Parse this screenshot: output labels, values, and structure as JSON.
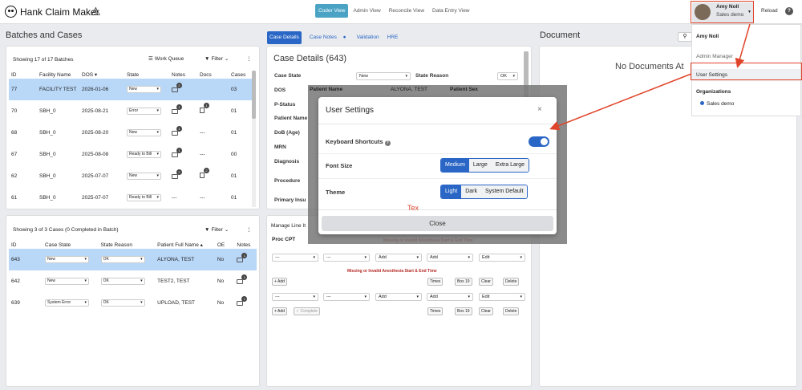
{
  "app": {
    "title": "Hank Claim Maker",
    "nav": [
      "Coder View",
      "Admin View",
      "Reconcile View",
      "Data Entry View"
    ],
    "active_nav": "Coder View"
  },
  "user": {
    "name": "Amy Noll",
    "org": "Sales demo",
    "reload": "Reload",
    "help": "?"
  },
  "dropdown": {
    "name": "Amy Noll",
    "role": "Admin Manager",
    "settings": "User Settings",
    "orgs_heading": "Organizations",
    "org": "Sales demo"
  },
  "batches": {
    "title": "Batches and Cases",
    "showing": "Showing 17 of 17 Batches",
    "work_queue": "Work Queue",
    "filter": "Filter",
    "headers": [
      "ID",
      "Facility Name",
      "DOS",
      "State",
      "Notes",
      "Docs",
      "Cases"
    ],
    "rows": [
      {
        "id": "77",
        "facility": "FACILITY TEST",
        "dos": "2026-01-06",
        "state": "New",
        "notes": "2",
        "docs": "",
        "cases": "03"
      },
      {
        "id": "70",
        "facility": "SBH_0",
        "dos": "2025-08-21",
        "state": "Error",
        "notes": "1",
        "docs": "1",
        "cases": "01"
      },
      {
        "id": "68",
        "facility": "SBH_0",
        "dos": "2025-08-20",
        "state": "New",
        "notes": "1",
        "docs": "---",
        "cases": "01"
      },
      {
        "id": "67",
        "facility": "SBH_0",
        "dos": "2025-08-08",
        "state": "Ready to Bill",
        "notes": "1",
        "docs": "---",
        "cases": "00"
      },
      {
        "id": "62",
        "facility": "SBH_0",
        "dos": "2025-07-07",
        "state": "New",
        "notes": "2",
        "docs": "2",
        "cases": "01"
      },
      {
        "id": "61",
        "facility": "SBH_0",
        "dos": "2025-07-07",
        "state": "Ready to Bill",
        "notes": "---",
        "docs": "---",
        "cases": "01"
      }
    ]
  },
  "cases": {
    "showing": "Showing 3 of 3 Cases (0 Completed in Batch)",
    "filter": "Filter",
    "headers": [
      "ID",
      "Case State",
      "State Reason",
      "Patient Full Name",
      "OE",
      "Notes"
    ],
    "rows": [
      {
        "id": "643",
        "state": "New",
        "reason": "OK",
        "name": "ALYONA, TEST",
        "oe": "No",
        "notes": "1"
      },
      {
        "id": "642",
        "state": "New",
        "reason": "OK",
        "name": "TEST2, TEST",
        "oe": "No",
        "notes": "1"
      },
      {
        "id": "639",
        "state": "System Error",
        "reason": "OK",
        "name": "UPLOAD, TEST",
        "oe": "No",
        "notes": "1"
      }
    ]
  },
  "case_details": {
    "tabs": [
      "Case Details",
      "Case Notes",
      "Validation",
      "HRE"
    ],
    "title": "Case Details (643)",
    "labels": [
      "Case State",
      "DOS",
      "P-Status",
      "Patient Name",
      "DoB (Age)",
      "MRN",
      "Diagnosis",
      "Procedure",
      "Primary Insu"
    ],
    "case_state": "New",
    "state_reason_label": "State Reason",
    "state_reason": "OK",
    "bg_patient_name": "Patient Name",
    "bg_patient": "ALYONA, TEST",
    "bg_patient_sex": "Patient Sex"
  },
  "lines": {
    "manage": "Manage Line It",
    "proc_cpt": "Proc CPT",
    "warning": "Missing or Invalid Anesthesia Start & End Time",
    "add": "Add",
    "edit": "Edit",
    "placeholder": "---",
    "add_btn": "+ Add",
    "complete": "Complete",
    "times": "Times",
    "box19": "Box 19",
    "clear": "Clear",
    "delete": "Delete"
  },
  "document": {
    "title": "Document",
    "empty": "No Documents At"
  },
  "settings": {
    "title": "User Settings",
    "close_x": "×",
    "kb_label": "Keyboard Shortcuts",
    "font_label": "Font Size",
    "font_options": [
      "Medium",
      "Large",
      "Extra Large"
    ],
    "font_selected": "Medium",
    "theme_label": "Theme",
    "theme_options": [
      "Light",
      "Dark",
      "System Default"
    ],
    "theme_selected": "Light",
    "close": "Close",
    "partial": "Tex"
  }
}
